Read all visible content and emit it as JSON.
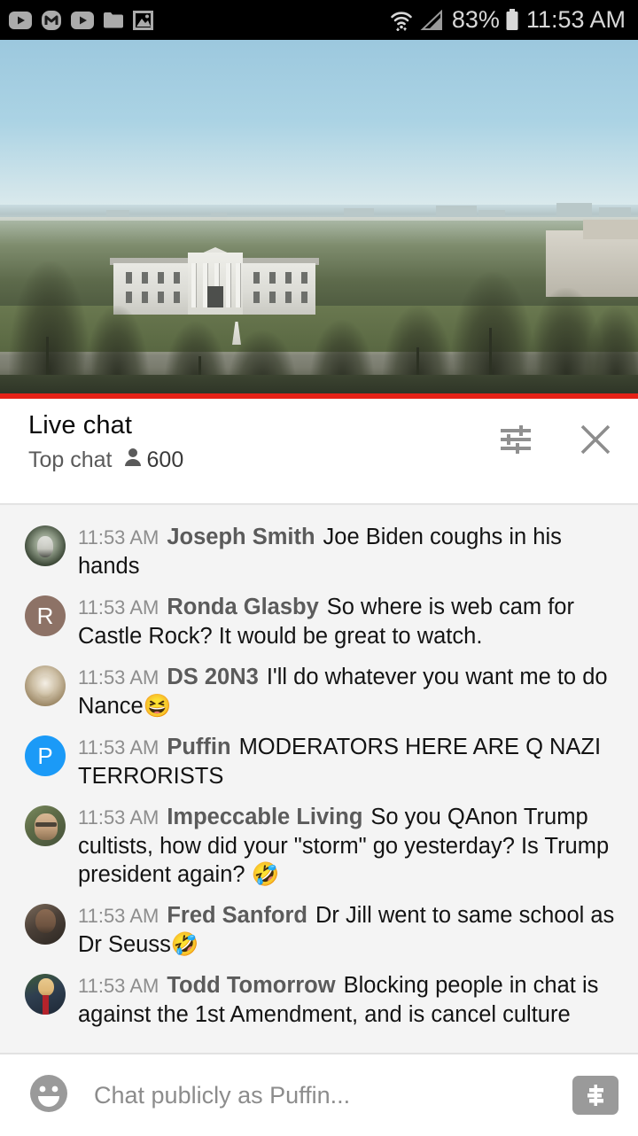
{
  "status_bar": {
    "background": "#000000",
    "left_icons": [
      {
        "name": "youtube-icon",
        "glyph": "▶"
      },
      {
        "name": "gmail-m-icon",
        "glyph": "M"
      },
      {
        "name": "youtube-music-icon",
        "glyph": "▶"
      },
      {
        "name": "folder-icon",
        "glyph": "🗀"
      },
      {
        "name": "photos-image-icon",
        "glyph": "🖼"
      }
    ],
    "wifi_icon": "wifi-icon",
    "signal_icon": "cell-signal-icon",
    "battery_percent": "83%",
    "battery_icon": "battery-icon",
    "clock": "11:53 AM"
  },
  "video": {
    "name": "white-house-live-stream",
    "progress_color": "#e62117",
    "progress_percent": 100
  },
  "chat_header": {
    "title": "Live chat",
    "mode": "Top chat",
    "viewer_icon": "person-icon",
    "viewer_count": "600",
    "settings_icon": "tune-sliders-icon",
    "close_icon": "close-x-icon"
  },
  "messages": [
    {
      "time": "11:53 AM",
      "author": "Joseph Smith",
      "text": "Joe Biden coughs in his hands",
      "avatar_type": "photo",
      "avatar_class": "av-panda",
      "avatar_letter": ""
    },
    {
      "time": "11:53 AM",
      "author": "Ronda Glasby",
      "text": "So where is web cam for Castle Rock? It would be great to watch.",
      "avatar_type": "letter",
      "avatar_class": "av-letter-r",
      "avatar_letter": "R"
    },
    {
      "time": "11:53 AM",
      "author": "DS 20N3",
      "text": "I'll do whatever you want me to do Nance😆",
      "avatar_type": "photo",
      "avatar_class": "av-coin",
      "avatar_letter": ""
    },
    {
      "time": "11:53 AM",
      "author": "Puffin",
      "text": "MODERATORS HERE ARE Q NAZI TERRORISTS",
      "avatar_type": "letter",
      "avatar_class": "av-letter-p",
      "avatar_letter": "P"
    },
    {
      "time": "11:53 AM",
      "author": "Impeccable Living",
      "text": "So you QAnon Trump cultists, how did your \"storm\" go yesterday? Is Trump president again? 🤣",
      "avatar_type": "photo",
      "avatar_class": "av-glasses",
      "avatar_letter": ""
    },
    {
      "time": "11:53 AM",
      "author": "Fred Sanford",
      "text": "Dr Jill went to same school as Dr Seuss🤣",
      "avatar_type": "photo",
      "avatar_class": "av-fred",
      "avatar_letter": ""
    },
    {
      "time": "11:53 AM",
      "author": "Todd Tomorrow",
      "text": "Blocking people in chat is against the 1st Amendment, and is cancel culture",
      "avatar_type": "photo",
      "avatar_class": "av-trump",
      "avatar_letter": ""
    }
  ],
  "input_bar": {
    "emoji_icon": "emoji-smiley-icon",
    "placeholder": "Chat publicly as Puffin...",
    "value": "",
    "superchat_icon": "dollar-sign-icon"
  }
}
